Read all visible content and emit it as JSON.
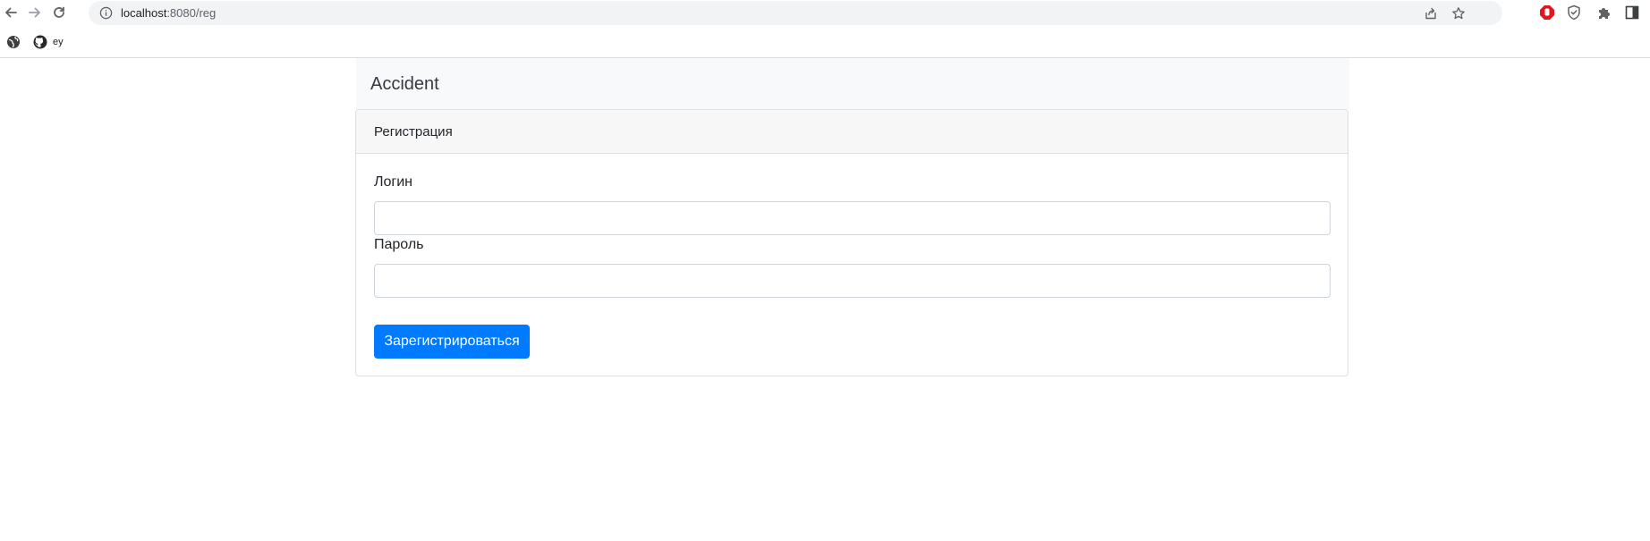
{
  "browser": {
    "url_host": "localhost",
    "url_path": ":8080/reg",
    "icons": {
      "back": "arrow-left-icon",
      "forward": "arrow-right-icon",
      "reload": "reload-icon",
      "info": "info-icon",
      "share": "share-icon",
      "bookmark": "star-icon",
      "ext_adblock": "stop-hand-icon",
      "ext_shield": "shield-check-icon",
      "extensions": "puzzle-icon",
      "side_panel": "side-panel-icon"
    },
    "bookmarks": [
      {
        "label": "",
        "icon": "globe-icon"
      },
      {
        "label": "ey",
        "icon": "github-icon"
      }
    ]
  },
  "page": {
    "brand": "Accident",
    "form": {
      "title": "Регистрация",
      "login_label": "Логин",
      "login_value": "",
      "password_label": "Пароль",
      "password_value": "",
      "submit_label": "Зарегистрироваться"
    }
  },
  "colors": {
    "primary": "#007bff",
    "header_bg": "#f8f9fa",
    "card_header_bg": "#f7f7f7"
  }
}
